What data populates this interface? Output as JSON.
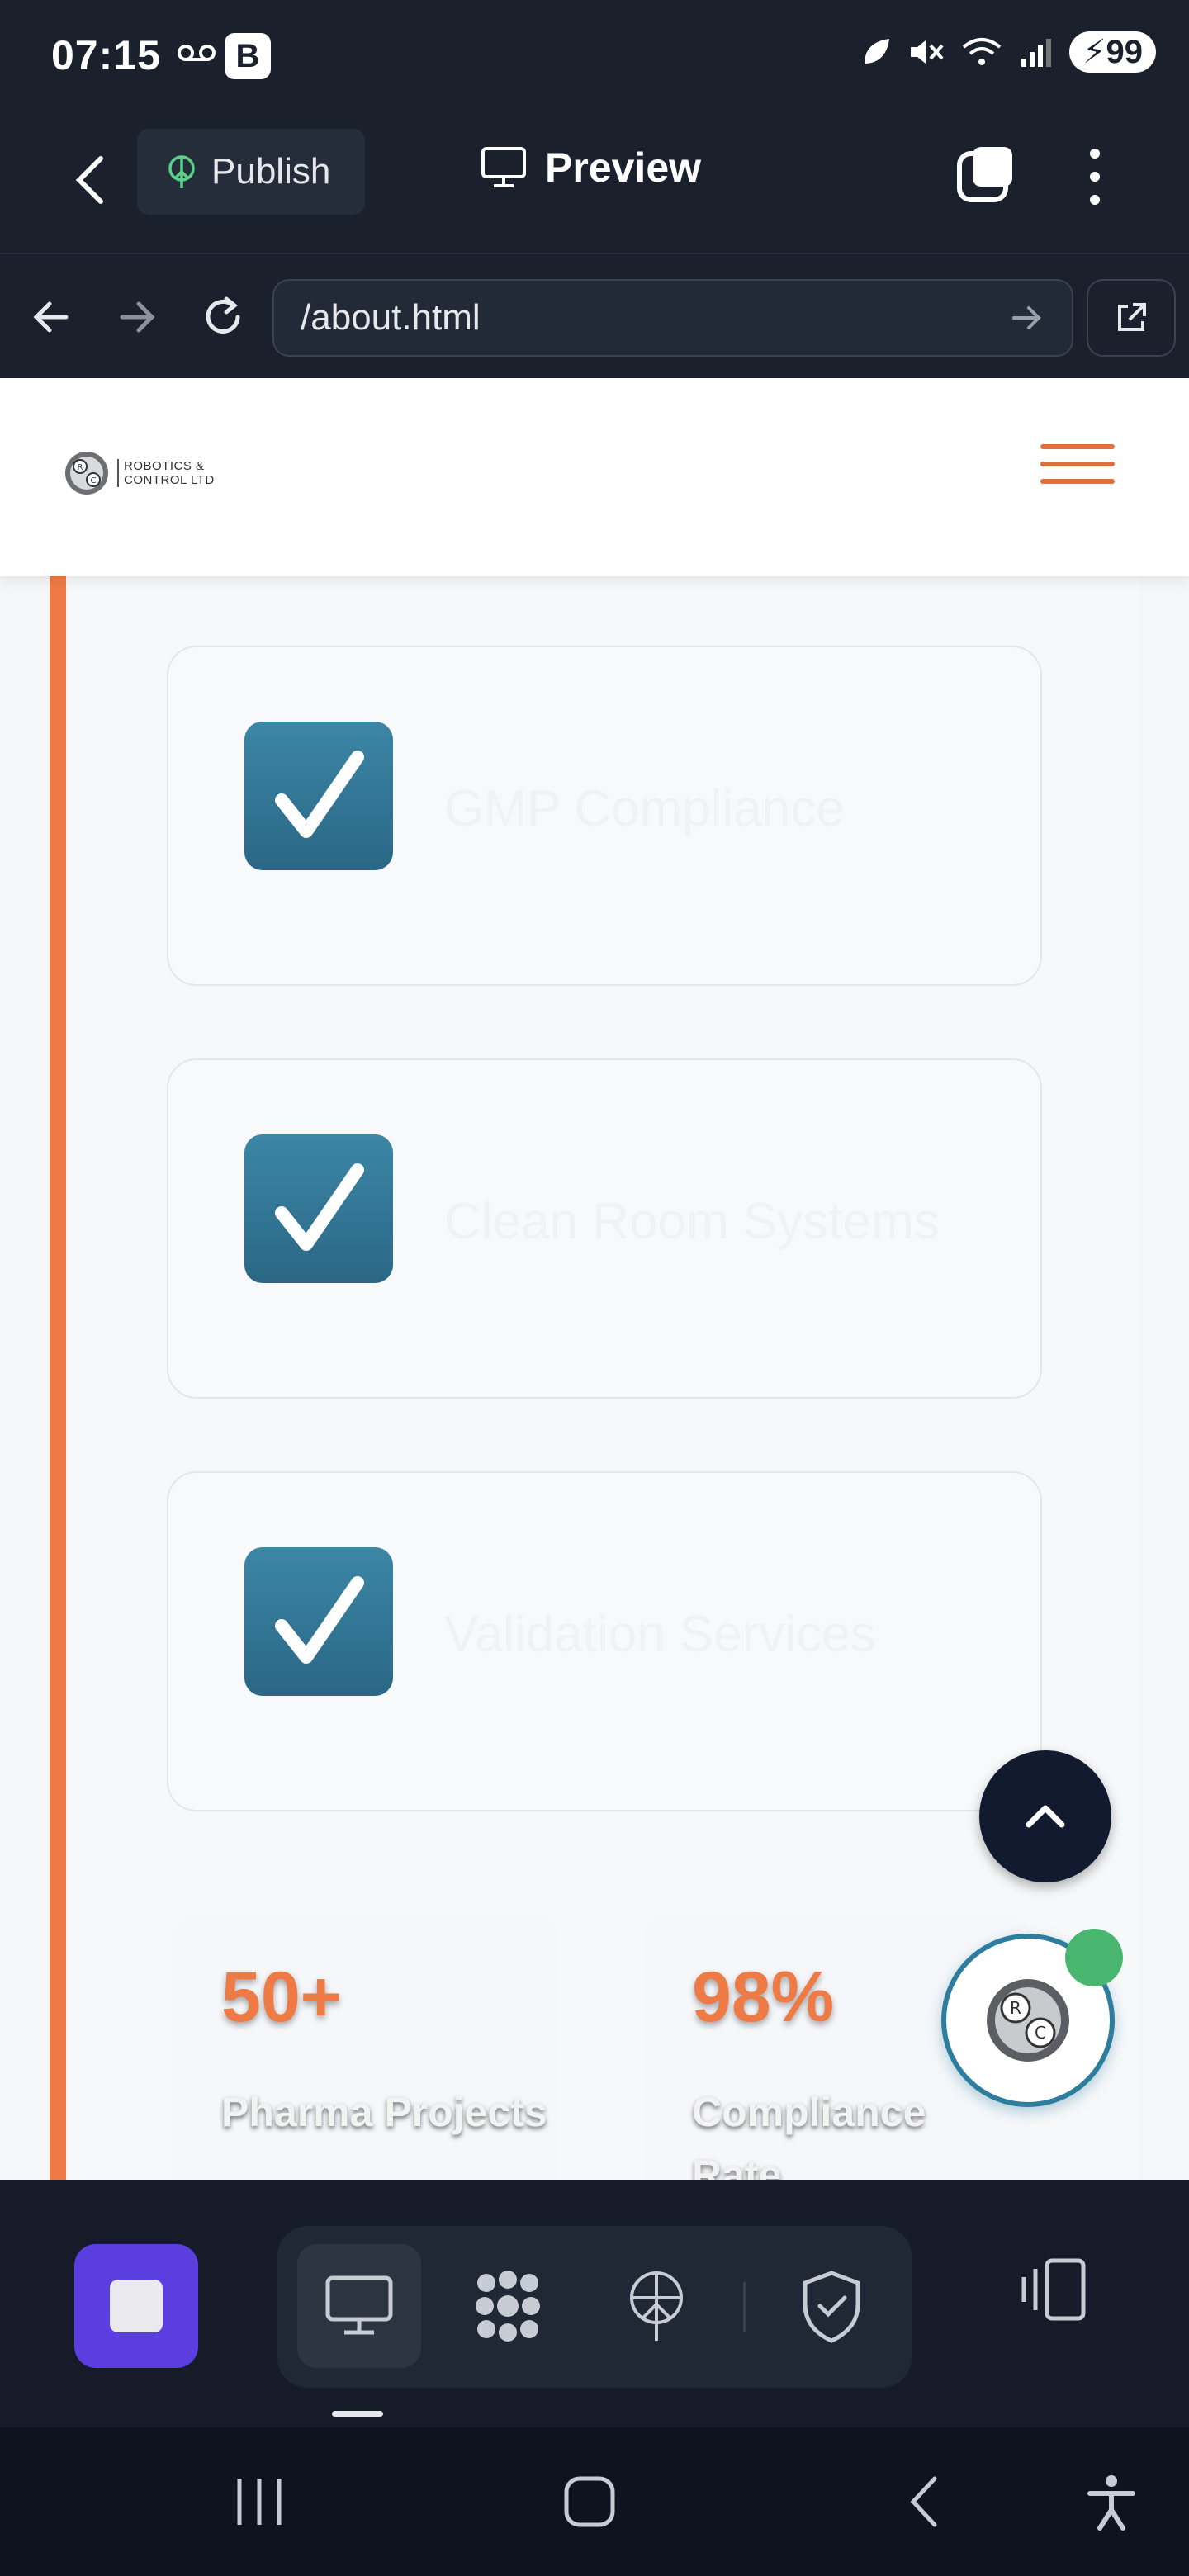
{
  "status_bar": {
    "time": "07:15",
    "voicemail_icon": "voicemail-icon",
    "b_badge": "B",
    "battery": "99"
  },
  "toolbar": {
    "publish_label": "Publish",
    "preview_label": "Preview"
  },
  "url_bar": {
    "url": "/about.html"
  },
  "site": {
    "logo_text_line1": "ROBOTICS &",
    "logo_text_line2": "CONTROL LTD",
    "accent_color": "#ee7a45",
    "check_color": "#2f7193"
  },
  "features": [
    {
      "label": "GMP Compliance"
    },
    {
      "label": "Clean Room Systems"
    },
    {
      "label": "Validation Services"
    }
  ],
  "stats": [
    {
      "value": "50+",
      "label": "Pharma Projects"
    },
    {
      "value": "98%",
      "label": "Compliance Rate"
    }
  ],
  "bottom_tools": [
    "desktop-icon",
    "apps-icon",
    "publish-icon",
    "shield-check-icon"
  ]
}
